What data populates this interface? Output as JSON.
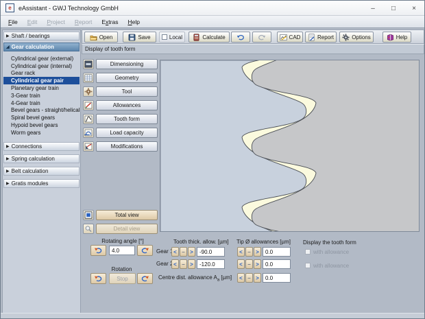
{
  "window": {
    "title": "eAssistant - GWJ Technology GmbH",
    "icon_letter": "e",
    "controls": {
      "minimize": "–",
      "maximize": "□",
      "close": "×"
    }
  },
  "menu": {
    "items": [
      {
        "pre": "",
        "accel": "F",
        "post": "ile",
        "enabled": true
      },
      {
        "pre": "",
        "accel": "E",
        "post": "dit",
        "enabled": false
      },
      {
        "pre": "",
        "accel": "P",
        "post": "roject",
        "enabled": false
      },
      {
        "pre": "",
        "accel": "R",
        "post": "eport",
        "enabled": false
      },
      {
        "pre": "E",
        "accel": "x",
        "post": "tras",
        "enabled": true
      },
      {
        "pre": "",
        "accel": "H",
        "post": "elp",
        "enabled": true
      }
    ]
  },
  "toolbar": {
    "open": "Open",
    "save": "Save",
    "local": "Local",
    "calculate": "Calculate",
    "cad": "CAD",
    "report": "Report",
    "options": "Options",
    "help": "Help"
  },
  "display_bar": {
    "title": "Display of tooth form"
  },
  "sidebar": {
    "rows": [
      {
        "kind": "header",
        "arrow": "▶",
        "label": "Shaft / bearings"
      },
      {
        "kind": "header-active",
        "arrow": "◢",
        "label": "Gear calculation"
      },
      {
        "kind": "item",
        "label": "Cylindrical gear (external)"
      },
      {
        "kind": "item",
        "label": "Cylindrical gear (internal)"
      },
      {
        "kind": "item",
        "label": "Gear rack"
      },
      {
        "kind": "item-selected",
        "label": "Cylindrical gear pair"
      },
      {
        "kind": "item",
        "label": "Planetary gear train"
      },
      {
        "kind": "item",
        "label": "3-Gear train"
      },
      {
        "kind": "item",
        "label": "4-Gear train"
      },
      {
        "kind": "item",
        "label": "Bevel gears - straight/helical"
      },
      {
        "kind": "item",
        "label": "Spiral bevel gears"
      },
      {
        "kind": "item",
        "label": "Hypoid bevel gears"
      },
      {
        "kind": "item",
        "label": "Worm gears"
      },
      {
        "kind": "header",
        "arrow": "▶",
        "label": "Connections"
      },
      {
        "kind": "header",
        "arrow": "▶",
        "label": "Spring calculation"
      },
      {
        "kind": "header",
        "arrow": "▶",
        "label": "Belt calculation"
      },
      {
        "kind": "header",
        "arrow": "▶",
        "label": "Gratis modules"
      }
    ]
  },
  "nav": {
    "buttons": [
      "Dimensioning",
      "Geometry",
      "Tool",
      "Allowances",
      "Tooth form",
      "Load capacity",
      "Modifications"
    ]
  },
  "view": {
    "total": "Total view",
    "detail": "Detail view"
  },
  "controls": {
    "rotating_angle_label": "Rotating angle [°]",
    "rotating_angle_value": "4.0",
    "rotation_label": "Rotation",
    "stop_label": "Stop",
    "tooth_thick_header": "Tooth thick. allow. [µm]",
    "tip_header": "Tip Ø allowances [µm]",
    "gear1_label": "Gear 1",
    "gear2_label": "Gear 2",
    "gear1_thick": "-90.0",
    "gear2_thick": "-120.0",
    "gear1_tip": "0.0",
    "gear2_tip": "0.0",
    "centre_label_main": "Centre dist. allowance A",
    "centre_label_sub": "a",
    "centre_label_unit": " [µm]",
    "centre_value": "0.0",
    "display_header": "Display the tooth form",
    "with_allowance_1": "with allowance",
    "with_allowance_2": "with allowance",
    "spin": {
      "left": "<",
      "minus": "–",
      "right": ">"
    }
  },
  "colors": {
    "canvas_bg": "#c8d1dd",
    "gear_gray": "#c6c7c9",
    "gear_cream": "#fbfade",
    "outline": "#4a4e55",
    "selected_blue": "#1d4f9b",
    "header_blue": "#5d86ad"
  }
}
